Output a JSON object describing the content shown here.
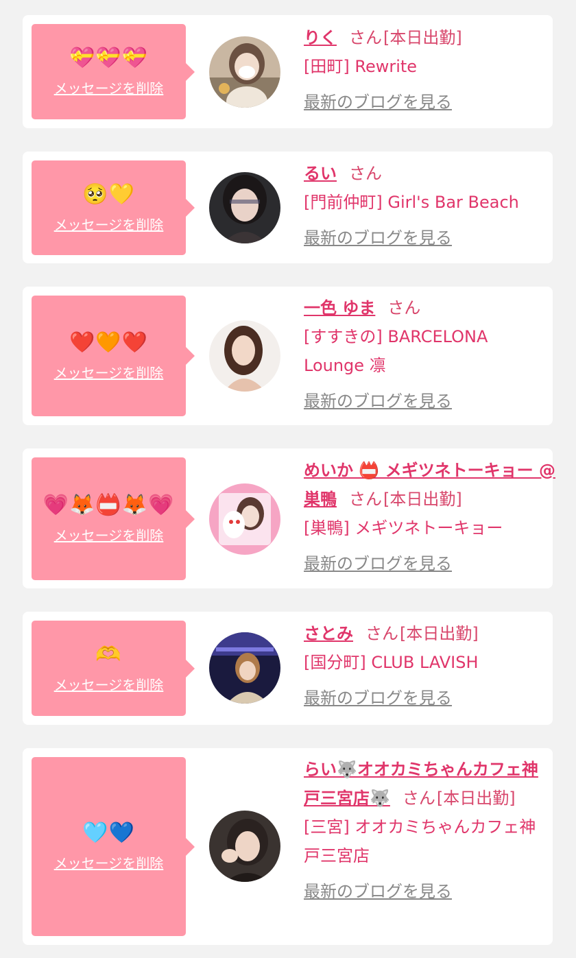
{
  "colors": {
    "accent": "#e0356a",
    "bubble": "#ff97a8",
    "card": "#ffffff",
    "background": "#f2f2f2",
    "link_gray": "#888888"
  },
  "entries": [
    {
      "emoji": "💝💝💝",
      "delete_label": "メッセージを削除",
      "name": "りく",
      "honorific": "さん",
      "shift": "[本日出勤]",
      "shop": "[田町] Rewrite",
      "blog_label": "最新のブログを見る"
    },
    {
      "emoji": "🥺💛",
      "delete_label": "メッセージを削除",
      "name": "るい",
      "honorific": "さん",
      "shift": "",
      "shop": "[門前仲町] Girl's Bar Beach",
      "blog_label": "最新のブログを見る"
    },
    {
      "emoji": "❤️🧡❤️",
      "delete_label": "メッセージを削除",
      "name": "一色 ゆま",
      "honorific": "さん",
      "shift": "",
      "shop": "[すすきの] BARCELONA Lounge 凛",
      "blog_label": "最新のブログを見る"
    },
    {
      "emoji": "💗🦊📛🦊💗",
      "delete_label": "メッセージを削除",
      "name": "めいか 📛 メギツネトーキョー @ 巣鴨",
      "honorific": "さん",
      "shift": "[本日出勤]",
      "shop": "[巣鴨] メギツネトーキョー",
      "blog_label": "最新のブログを見る"
    },
    {
      "emoji": "🫶",
      "delete_label": "メッセージを削除",
      "name": "さとみ",
      "honorific": "さん",
      "shift": "[本日出勤]",
      "shop": "[国分町] CLUB LAVISH",
      "blog_label": "最新のブログを見る"
    },
    {
      "emoji": "🩵💙",
      "delete_label": "メッセージを削除",
      "name": "らい🐺オオカミちゃんカフェ神戸三宮店🐺",
      "honorific": "さん",
      "shift": "[本日出勤]",
      "shop": "[三宮] オオカミちゃんカフェ神戸三宮店",
      "blog_label": "最新のブログを見る"
    }
  ]
}
